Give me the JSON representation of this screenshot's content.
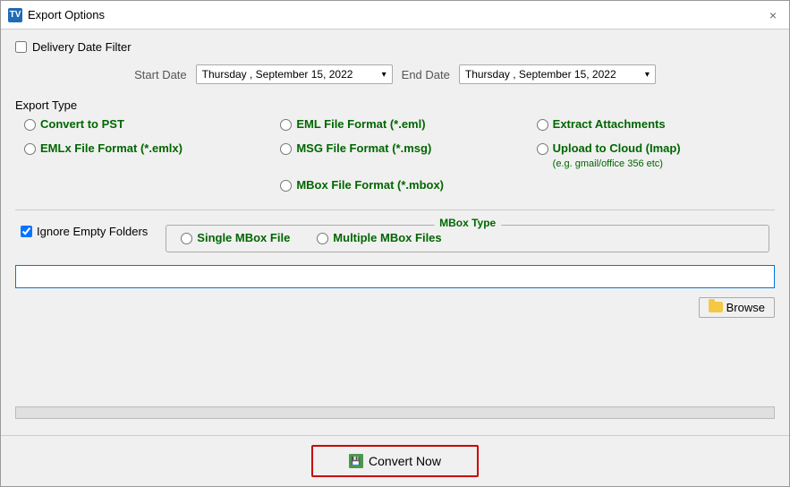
{
  "window": {
    "title": "Export Options",
    "close_label": "×"
  },
  "delivery": {
    "checkbox_label": "Delivery Date Filter",
    "start_label": "Start Date",
    "end_label": "End Date",
    "start_date": "Thursday , September 15, 2022",
    "end_date": "Thursday , September 15, 2022"
  },
  "export_type": {
    "section_label": "Export Type",
    "options": [
      {
        "id": "pst",
        "label": "Convert to PST",
        "col": 0,
        "row": 0
      },
      {
        "id": "eml",
        "label": "EML File  Format (*.eml)",
        "col": 1,
        "row": 0
      },
      {
        "id": "extract",
        "label": "Extract Attachments",
        "col": 2,
        "row": 0
      },
      {
        "id": "emlx",
        "label": "EMLx File  Format (*.emlx)",
        "col": 0,
        "row": 1
      },
      {
        "id": "msg",
        "label": "MSG File Format (*.msg)",
        "col": 1,
        "row": 1
      },
      {
        "id": "cloud",
        "label": "Upload to Cloud (Imap)",
        "sublabel": "(e.g. gmail/office 356 etc)",
        "col": 2,
        "row": 1
      },
      {
        "id": "mbox",
        "label": "MBox File Format (*.mbox)",
        "col": 1,
        "row": 2
      }
    ]
  },
  "options": {
    "ignore_empty": "Ignore Empty Folders",
    "mbox_type_legend": "MBox Type",
    "single_mbox": "Single MBox File",
    "multiple_mbox": "Multiple MBox Files"
  },
  "path": {
    "placeholder": ""
  },
  "browse": {
    "label": "Browse"
  },
  "convert": {
    "label": "Convert Now"
  }
}
